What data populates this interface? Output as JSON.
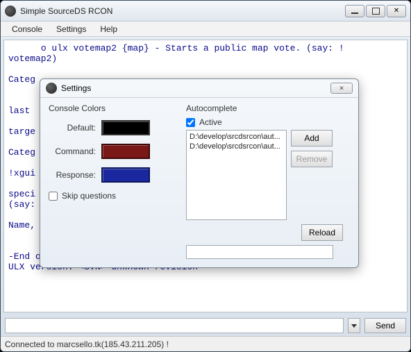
{
  "window": {
    "title": "Simple SourceDS RCON"
  },
  "menu": {
    "console": "Console",
    "settings": "Settings",
    "help": "Help"
  },
  "console_text": "      o ulx votemap2 {map} - Starts a public map vote. (say: !\nvotemap2)\n\nCateg\n\n                                                         t  to\nlast   \n\ntarge\n\nCateg\n                                                         say:\n!xgui                                                     \n                                                         the\nspeci\n(say:\n                                                         out\nName,                                                     an)\n\n\n-End of help\nULX version: <SVN> unknown revision",
  "send_label": "Send",
  "status": "Connected to marcsello.tk(185.43.211.205) !",
  "dialog": {
    "title": "Settings",
    "colors_label": "Console Colors",
    "default_label": "Default:",
    "command_label": "Command:",
    "response_label": "Response:",
    "skip_label": "Skip questions",
    "autocomplete_label": "Autocomplete",
    "active_label": "Active",
    "active_checked": true,
    "items": [
      "D:\\develop\\srcdsrcon\\aut...",
      "D:\\develop\\srcdsrcon\\aut..."
    ],
    "add_label": "Add",
    "remove_label": "Remove",
    "reload_label": "Reload",
    "colors": {
      "default": "#000000",
      "command": "#7a1818",
      "response": "#1a28a0"
    }
  }
}
